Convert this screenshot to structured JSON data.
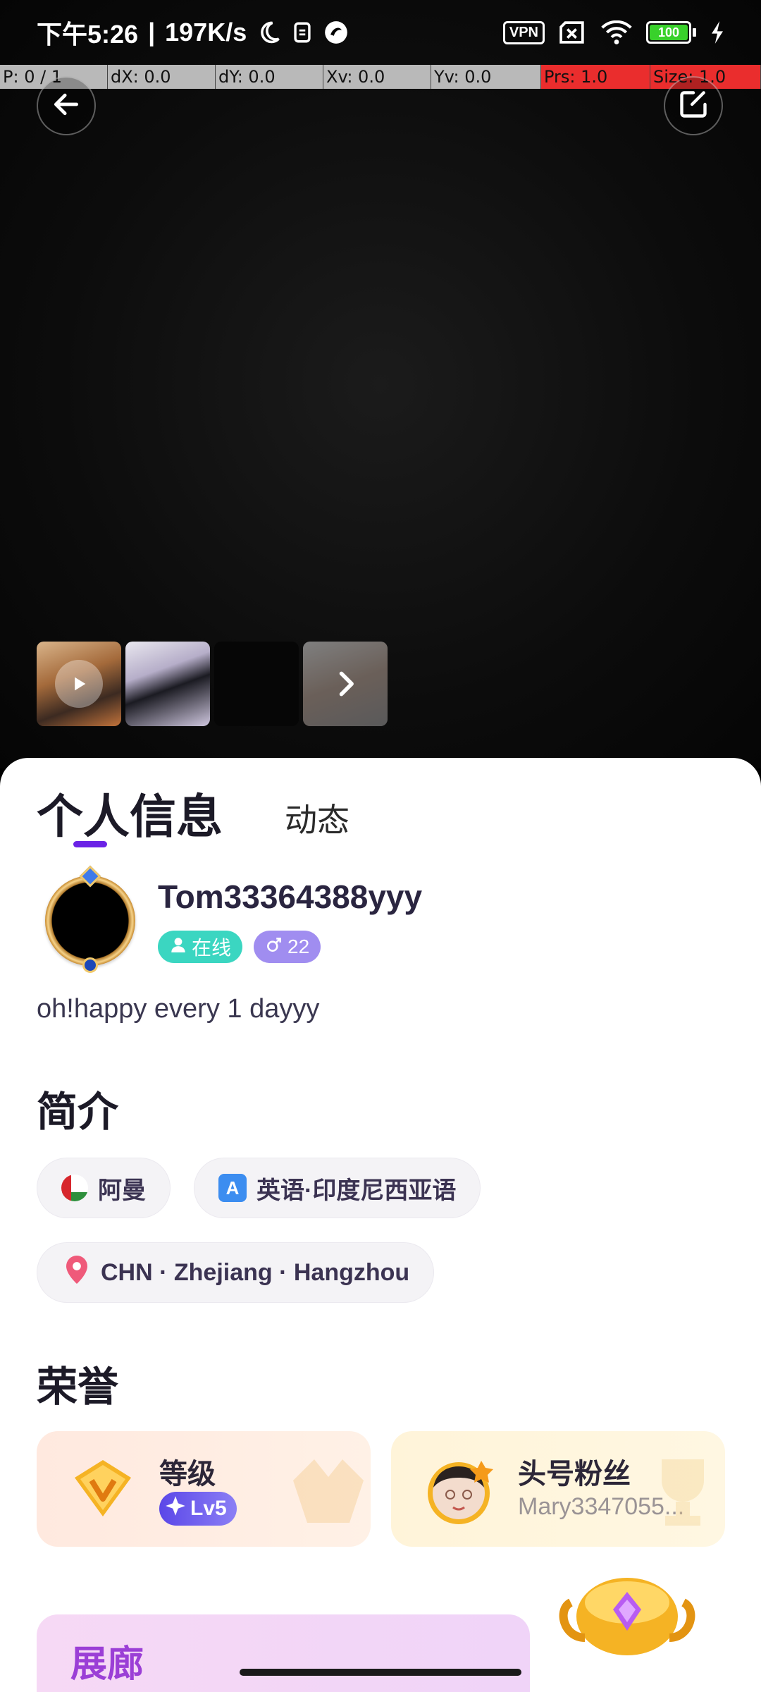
{
  "status_bar": {
    "time": "下午5:26",
    "separator": "|",
    "net_speed": "197K/s",
    "vpn_label": "VPN",
    "battery_level": "100"
  },
  "debug_overlay": {
    "p": "P: 0 / 1",
    "dx": "dX: 0.0",
    "dy": "dY: 0.0",
    "xv": "Xv: 0.0",
    "yv": "Yv: 0.0",
    "prs": "Prs: 1.0",
    "size": "Size: 1.0"
  },
  "tabs": {
    "profile": "个人信息",
    "moments": "动态"
  },
  "profile": {
    "username": "Tom33364388yyy",
    "status": "在线",
    "age": "22",
    "bio": "oh!happy every 1 dayyy"
  },
  "intro": {
    "title": "简介",
    "country": "阿曼",
    "languages": "英语·印度尼西亚语",
    "location": "CHN · Zhejiang · Hangzhou"
  },
  "honors": {
    "title": "荣誉",
    "level_title": "等级",
    "level_value": "Lv5",
    "top_fan_title": "头号粉丝",
    "top_fan_name": "Mary3347055..."
  },
  "gallery": {
    "label": "展廊"
  },
  "colors": {
    "accent": "#6b22e6",
    "online": "#3bd6c1",
    "age_badge": "#a08df0",
    "location_pin": "#ef5a7a"
  },
  "icons": {
    "back": "arrow-left-icon",
    "edit": "edit-icon",
    "play": "play-icon",
    "more": "chevron-right-icon",
    "location": "location-pin-icon"
  }
}
